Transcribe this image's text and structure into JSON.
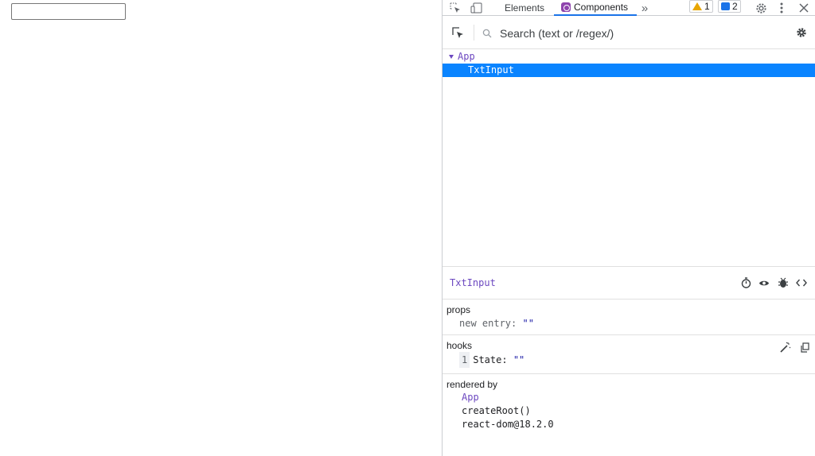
{
  "page": {
    "input_value": ""
  },
  "devtools": {
    "tabs": [
      {
        "label": "Elements"
      },
      {
        "label": "Components"
      }
    ],
    "overflow_glyph": "»",
    "warnings_count": "1",
    "messages_count": "2",
    "search": {
      "placeholder": "Search (text or /regex/)"
    },
    "tree": {
      "root": "App",
      "selected": "TxtInput"
    },
    "inspector": {
      "component_name": "TxtInput",
      "props_title": "props",
      "props": [
        {
          "key": "new entry:",
          "value": "\"\""
        }
      ],
      "hooks_title": "hooks",
      "hooks": [
        {
          "index": "1",
          "key": "State:",
          "value": "\"\""
        }
      ],
      "rendered_by_title": "rendered by",
      "rendered_by": [
        "App",
        "createRoot()",
        "react-dom@18.2.0"
      ]
    },
    "colors": {
      "accent": "#1a73e8",
      "selection": "#0a84ff",
      "component": "#6c48c0"
    }
  }
}
